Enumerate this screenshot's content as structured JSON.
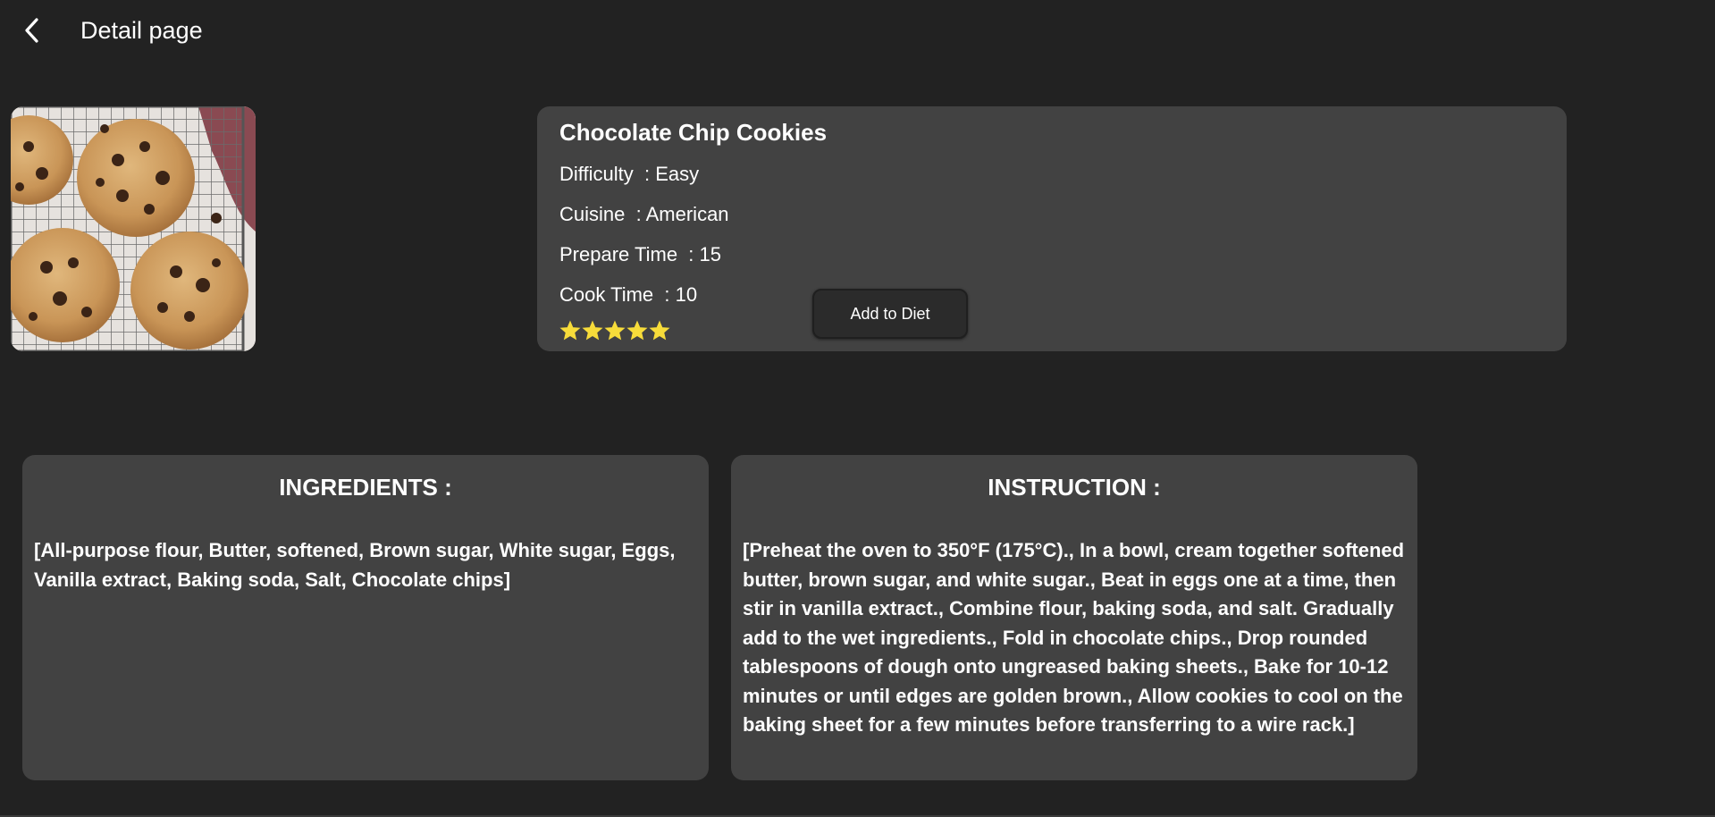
{
  "topbar": {
    "title": "Detail page",
    "back_icon": "chevron-left-icon"
  },
  "recipe": {
    "name": "Chocolate Chip Cookies",
    "image_alt": "cookies-photo",
    "rows": {
      "difficulty": {
        "label": "Difficulty",
        "value": "Easy"
      },
      "cuisine": {
        "label": "Cuisine",
        "value": "American"
      },
      "prepare_time": {
        "label": "Prepare Time",
        "value": "15"
      },
      "cook_time": {
        "label": "Cook Time",
        "value": "10"
      }
    },
    "rating": 5,
    "rating_max": 5,
    "star_icon": "star-icon",
    "star_color": "#f7dc3a"
  },
  "actions": {
    "add_to_diet_label": "Add to Diet"
  },
  "ingredients": {
    "title": "INGREDIENTS :",
    "text": "[All-purpose flour, Butter, softened, Brown sugar, White sugar, Eggs, Vanilla extract, Baking soda, Salt, Chocolate chips]"
  },
  "instruction": {
    "title": "INSTRUCTION :",
    "text": "[Preheat the oven to 350°F (175°C)., In a bowl, cream together softened butter, brown sugar, and white sugar., Beat in eggs one at a time, then stir in vanilla extract., Combine flour, baking soda, and salt. Gradually add to the wet ingredients., Fold in chocolate chips., Drop rounded tablespoons of dough onto ungreased baking sheets., Bake for 10-12 minutes or until edges are golden brown., Allow cookies to cool on the baking sheet for a few minutes before transferring to a wire rack.]"
  },
  "colors": {
    "background": "#222222",
    "card": "#424242",
    "text": "#ffffff"
  }
}
